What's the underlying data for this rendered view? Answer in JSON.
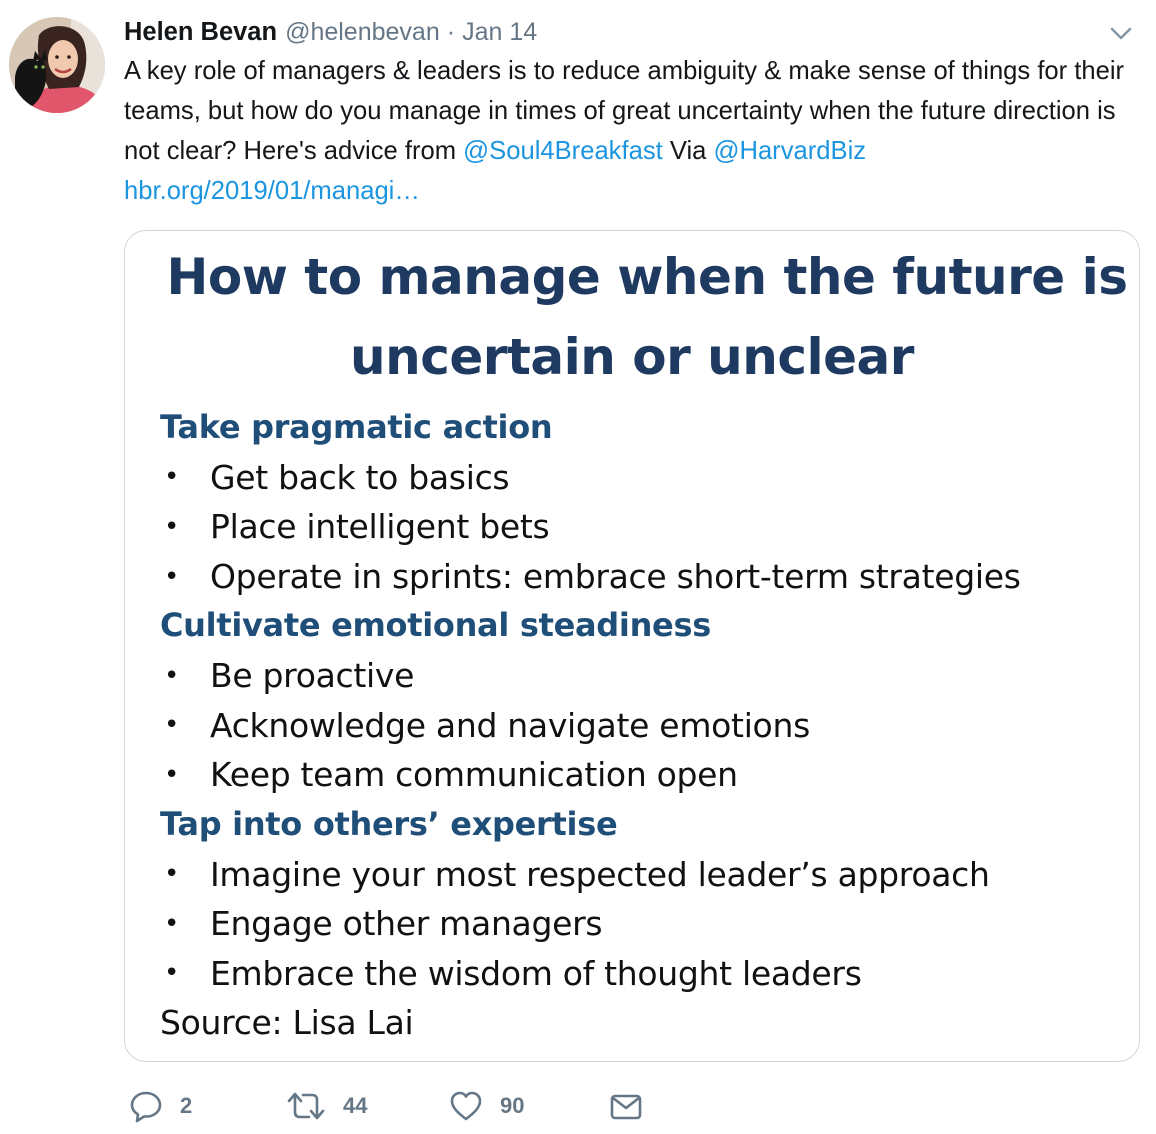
{
  "tweet": {
    "author_name": "Helen Bevan",
    "handle": "@helenbevan",
    "separator": "·",
    "date": "Jan 14",
    "text_1": "A key role of managers & leaders is to reduce ambiguity & make sense of things for their teams, but how do you manage in times of great uncertainty when the future direction is not clear? Here's advice from ",
    "mention_1": "@Soul4Breakfast",
    "text_2": " Via ",
    "mention_2": "@HarvardBiz",
    "text_3": " ",
    "url": "hbr.org/2019/01/managi…"
  },
  "card": {
    "title_line_1": "How to manage when the future is",
    "title_line_2": "uncertain or unclear",
    "sections": [
      {
        "heading": "Take pragmatic action",
        "bullets": [
          "Get back to basics",
          "Place intelligent bets",
          "Operate in sprints: embrace short-term strategies"
        ]
      },
      {
        "heading": "Cultivate emotional steadiness",
        "bullets": [
          "Be proactive",
          "Acknowledge and navigate emotions",
          "Keep team communication open"
        ]
      },
      {
        "heading": "Tap into others’ expertise",
        "bullets": [
          "Imagine your most respected leader’s approach",
          "Engage other managers",
          "Embrace the wisdom of thought leaders"
        ]
      }
    ],
    "bullet_glyph": "•",
    "source": "Source: Lisa Lai"
  },
  "actions": {
    "reply_count": "2",
    "retweet_count": "44",
    "like_count": "90",
    "reply_icon": "reply-bubble-icon",
    "retweet_icon": "retweet-icon",
    "like_icon": "heart-icon",
    "dm_icon": "envelope-icon",
    "menu_icon": "chevron-down-icon"
  },
  "colors": {
    "link": "#1b95e0",
    "muted": "#657786",
    "text": "#14171a",
    "slide_title": "#1f3a60",
    "slide_heading": "#1f4e79",
    "card_border": "#ccd6dd"
  }
}
